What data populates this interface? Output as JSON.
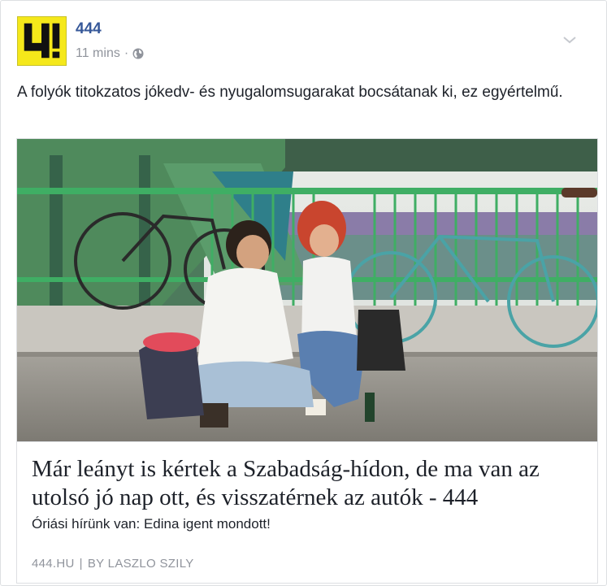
{
  "header": {
    "page_name": "444",
    "timestamp": "11 mins",
    "separator": "·",
    "privacy_icon": "globe-icon",
    "menu_icon": "chevron-down-icon",
    "avatar_logo_text": "4!",
    "avatar_color": "#f5e81a"
  },
  "post": {
    "text": "A folyók titokzatos jókedv- és nyugalomsugarakat bocsátanak ki, ez egyértelmű."
  },
  "link": {
    "title": "Már leányt is kértek a Szabadság-hídon, de ma van az utolsó jó nap ott, és visszatérnek az autók - 444",
    "description": "Óriási hírünk van: Edina igent mondott!",
    "domain": "444.HU",
    "divider": "|",
    "byline": "BY LASZLO SZILY"
  },
  "colors": {
    "link_blue": "#365899",
    "meta_gray": "#90949c",
    "bridge_green": "#4f8a5c",
    "rail_green": "#3fae64"
  }
}
